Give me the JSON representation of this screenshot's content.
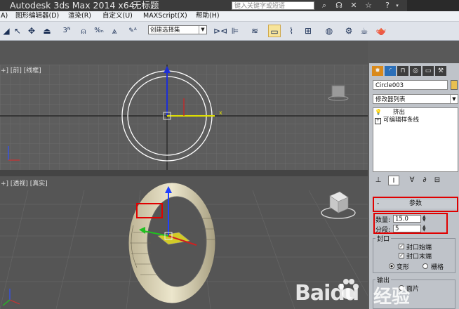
{
  "titlebar": {
    "app_title": "Autodesk 3ds Max  2014 x64",
    "document_title": "无标题",
    "search_placeholder": "键入关键字或短语"
  },
  "menubar": {
    "items": [
      "A)",
      "图形编辑器(D)",
      "渲染(R)",
      "自定义(U)",
      "MAXScript(X)",
      "帮助(H)"
    ]
  },
  "toolbar": {
    "selection_set_placeholder": "创建选择集",
    "snap_labels": [
      "3",
      "%",
      "n"
    ]
  },
  "viewports": {
    "top_label": "+] [前] [线框]",
    "perspective_label": "+] [透视] [真实]",
    "top_axis_x": "x"
  },
  "command_panel": {
    "object_name": "Circle003",
    "object_color": "#e8c050",
    "modifier_list": "修改器列表",
    "stack_items": [
      "挤出",
      "可编辑样条线"
    ],
    "rollout_title": "参数",
    "amount_label": "数量:",
    "amount_value": "15.0",
    "segments_label": "分段:",
    "segments_value": "5",
    "capping_group": "封口",
    "cap_start_label": "封口始端",
    "cap_end_label": "封口末端",
    "morph_label": "变形",
    "grid_label": "栅格",
    "output_group": "输出",
    "output_option": "面片"
  },
  "watermark": {
    "brand": "Baidu",
    "service": "经验"
  }
}
